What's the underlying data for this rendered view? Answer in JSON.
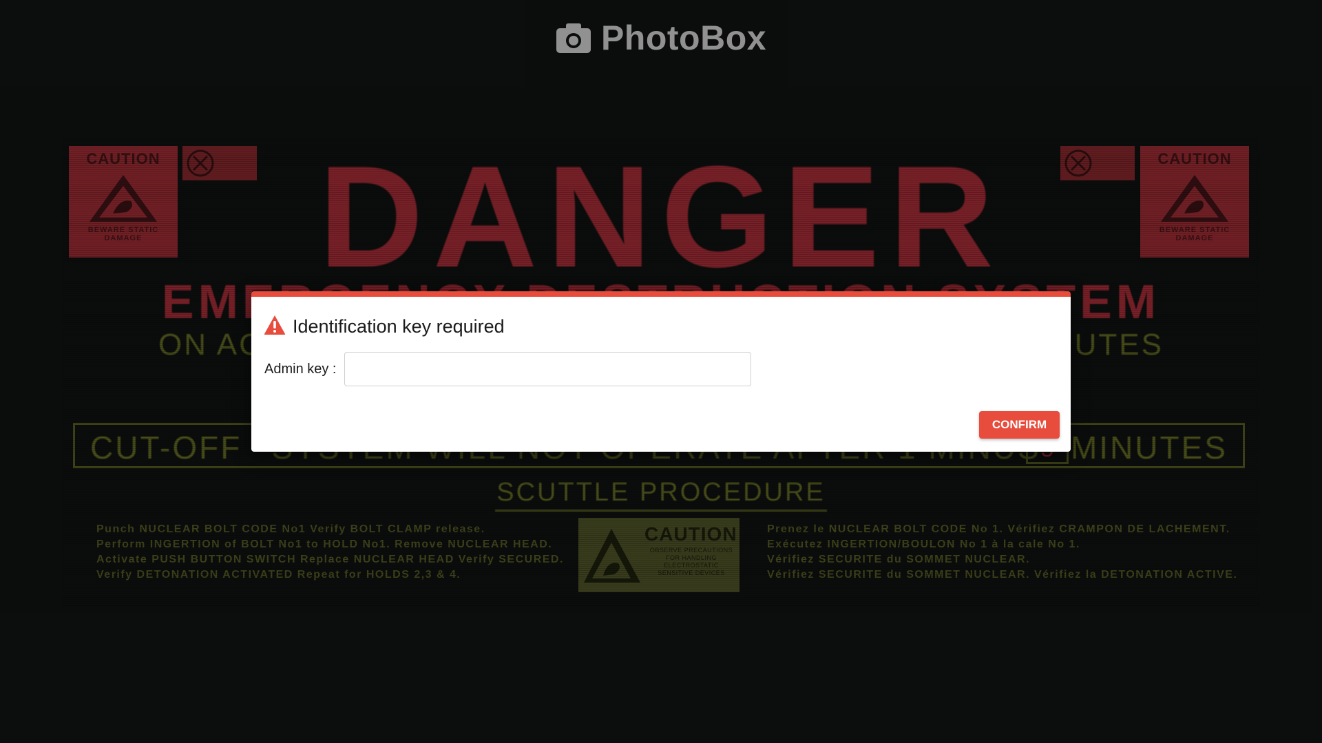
{
  "header": {
    "app_name": "PhotoBox",
    "logo_icon": "camera-icon"
  },
  "poster": {
    "title": "DANGER",
    "subtitle": "EMERGENCY DESTRUCTION SYSTEM",
    "activation_left": "ON AC",
    "activation_right": "NUTES",
    "cutoff_left": "CUT-OFF",
    "cutoff_middle": "SYSTEM WILL NOT OPERATE AFTER 1 MINUS",
    "cutoff_right": "MINUTES",
    "cutoff_number": "5",
    "scuttle_heading": "SCUTTLE PROCEDURE",
    "procedure_left": [
      "Punch NUCLEAR BOLT CODE No1 Verify BOLT CLAMP release.",
      "Perform INGERTION of BOLT No1 to HOLD No1. Remove NUCLEAR HEAD.",
      "Activate PUSH BUTTON SWITCH Replace NUCLEAR HEAD Verify SECURED.",
      "Verify DETONATION ACTIVATED Repeat for HOLDS 2,3 & 4."
    ],
    "procedure_right": [
      "Prenez le NUCLEAR BOLT CODE No 1. Vérifiez CRAMPON DE LACHEMENT.",
      "Exécutez INGERTION/BOULON No 1 à la cale No 1.",
      "Vérifiez SECURITE du SOMMET NUCLEAR.",
      "Vérifiez SECURITE du SOMMET NUCLEAR. Vérifiez la DETONATION ACTIVE."
    ],
    "caution_label": "CAUTION",
    "caution_sub_red": "BEWARE STATIC DAMAGE",
    "caution_sub_olive": "OBSERVE PRECAUTIONS FOR HANDLING ELECTROSTATIC SENSITIVE DEVICES"
  },
  "dialog": {
    "title": "Identification key required",
    "warning_icon": "warning-icon",
    "field_label": "Admin key :",
    "field_value": "",
    "field_placeholder": "",
    "confirm_label": "CONFIRM"
  },
  "colors": {
    "accent": "#e74c3c",
    "background": "#111313",
    "danger_red": "#b0303a",
    "olive": "#6a7226"
  }
}
